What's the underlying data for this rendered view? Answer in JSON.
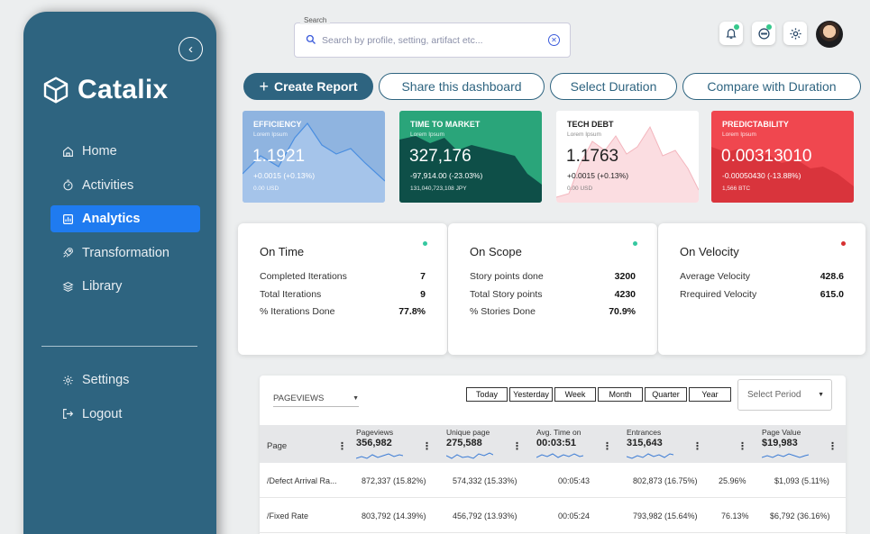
{
  "app": {
    "name": "Catalix"
  },
  "sidebar": {
    "nav": [
      {
        "label": "Home",
        "icon": "home-icon"
      },
      {
        "label": "Activities",
        "icon": "timer-icon"
      },
      {
        "label": "Analytics",
        "icon": "chart-icon",
        "active": true
      },
      {
        "label": "Transformation",
        "icon": "rocket-icon"
      },
      {
        "label": "Library",
        "icon": "layers-icon"
      }
    ],
    "bottom": [
      {
        "label": "Settings",
        "icon": "gear-icon"
      },
      {
        "label": "Logout",
        "icon": "logout-icon"
      }
    ]
  },
  "search": {
    "label": "Search",
    "placeholder": "Search by profile, setting, artifact etc..."
  },
  "actions": {
    "create": "Create Report",
    "share": "Share this dashboard",
    "duration": "Select Duration",
    "compare": "Compare with Duration"
  },
  "kpis": [
    {
      "title": "EFFICIENCY",
      "sub": "Lorem Ipsum",
      "value": "1.1921",
      "change": "+0.0015 (+0.13%)",
      "foot": "0.00 USD",
      "color": "#8fb4e0",
      "line": "#4a8ee0"
    },
    {
      "title": "TIME TO MARKET",
      "sub": "Lorem Ipsum",
      "value": "327,176",
      "change": "-97,914.00 (-23.03%)",
      "foot": "131,040,723,108 JPY",
      "color": "#2aa57a",
      "line": "#0e4f48"
    },
    {
      "title": "TECH DEBT",
      "sub": "Lorem Ipsum",
      "value": "1.1763",
      "change": "+0.0015 (+0.13%)",
      "foot": "0.00 USD",
      "color": "#ffffff",
      "line": "#f6c7cd"
    },
    {
      "title": "PREDICTABILITY",
      "sub": "Lorem Ipsum",
      "value": "0.00313010",
      "change": "-0.00050430 (-13.88%)",
      "foot": "1,566 BTC",
      "color": "#f0474f",
      "line": "#c82a33"
    }
  ],
  "stats": [
    {
      "title": "On Time",
      "dot": "#35c8a0",
      "rows": [
        {
          "label": "Completed Iterations",
          "value": "7"
        },
        {
          "label": "Total Iterations",
          "value": "9"
        },
        {
          "label": "% Iterations Done",
          "value": "77.8%"
        }
      ]
    },
    {
      "title": "On Scope",
      "dot": "#35c8a0",
      "rows": [
        {
          "label": "Story points done",
          "value": "3200"
        },
        {
          "label": "Total Story points",
          "value": "4230"
        },
        {
          "label": "% Stories Done",
          "value": "70.9%"
        }
      ]
    },
    {
      "title": "On Velocity",
      "dot": "#d63031",
      "rows": [
        {
          "label": "Average Velocity",
          "value": "428.6"
        },
        {
          "label": "Rrequired Velocity",
          "value": "615.0"
        }
      ]
    }
  ],
  "table": {
    "metric": "PAGEVIEWS",
    "periods": [
      "Today",
      "Yesterday",
      "Week",
      "Month",
      "Quarter",
      "Year"
    ],
    "period_placeholder": "Select Period",
    "columns": [
      {
        "label": "Page",
        "value": ""
      },
      {
        "label": "Pageviews",
        "value": "356,982"
      },
      {
        "label": "Unique page",
        "value": "275,588"
      },
      {
        "label": "Avg. Time on",
        "value": "00:03:51"
      },
      {
        "label": "Entrances",
        "value": "315,643"
      },
      {
        "label": "",
        "value": ""
      },
      {
        "label": "Page Value",
        "value": "$19,983"
      }
    ],
    "rows": [
      [
        "/Defect Arrival Ra...",
        "872,337 (15.82%)",
        "574,332 (15.33%)",
        "00:05:43",
        "802,873 (16.75%)",
        "25.96%",
        "$1,093 (5.11%)"
      ],
      [
        "/Fixed Rate",
        "803,792 (14.39%)",
        "456,792 (13.93%)",
        "00:05:24",
        "793,982 (15.64%)",
        "76.13%",
        "$6,792 (36.16%)"
      ]
    ]
  }
}
